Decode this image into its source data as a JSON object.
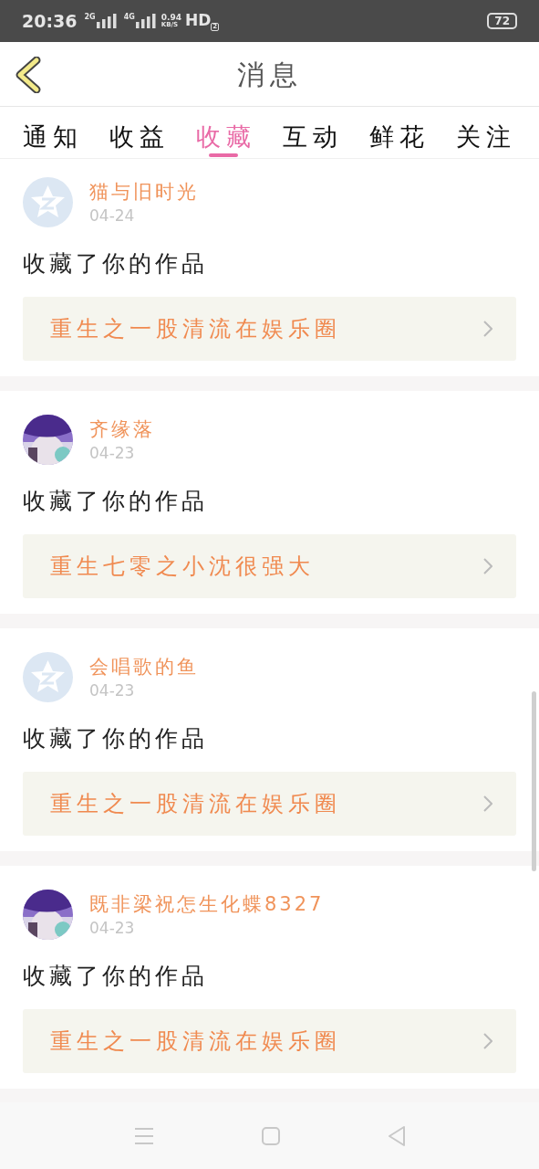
{
  "status_bar": {
    "time": "20:36",
    "sim_1": "2G",
    "sim_2": "4G",
    "speed_value": "0.94",
    "speed_unit": "KB/S",
    "hd": "HD",
    "hd_index": "2",
    "battery": "72"
  },
  "header": {
    "title": "消息"
  },
  "tabs": [
    {
      "label": "通知",
      "selected": false
    },
    {
      "label": "收益",
      "selected": false
    },
    {
      "label": "收藏",
      "selected": true
    },
    {
      "label": "互动",
      "selected": false
    },
    {
      "label": "鲜花",
      "selected": false
    },
    {
      "label": "关注",
      "selected": false
    }
  ],
  "messages": [
    {
      "kind": "default_avatar",
      "name": "猫与旧时光",
      "date": "04-24",
      "action": "收藏了你的作品",
      "work": "重生之一股清流在娱乐圈"
    },
    {
      "kind": "photo_avatar",
      "name": "齐缘落",
      "date": "04-23",
      "action": "收藏了你的作品",
      "work": "重生七零之小沈很强大"
    },
    {
      "kind": "default_avatar",
      "name": "会唱歌的鱼",
      "date": "04-23",
      "action": "收藏了你的作品",
      "work": "重生之一股清流在娱乐圈"
    },
    {
      "kind": "photo_avatar",
      "name": "既非梁祝怎生化蝶8327",
      "date": "04-23",
      "action": "收藏了你的作品",
      "work": "重生之一股清流在娱乐圈"
    }
  ]
}
